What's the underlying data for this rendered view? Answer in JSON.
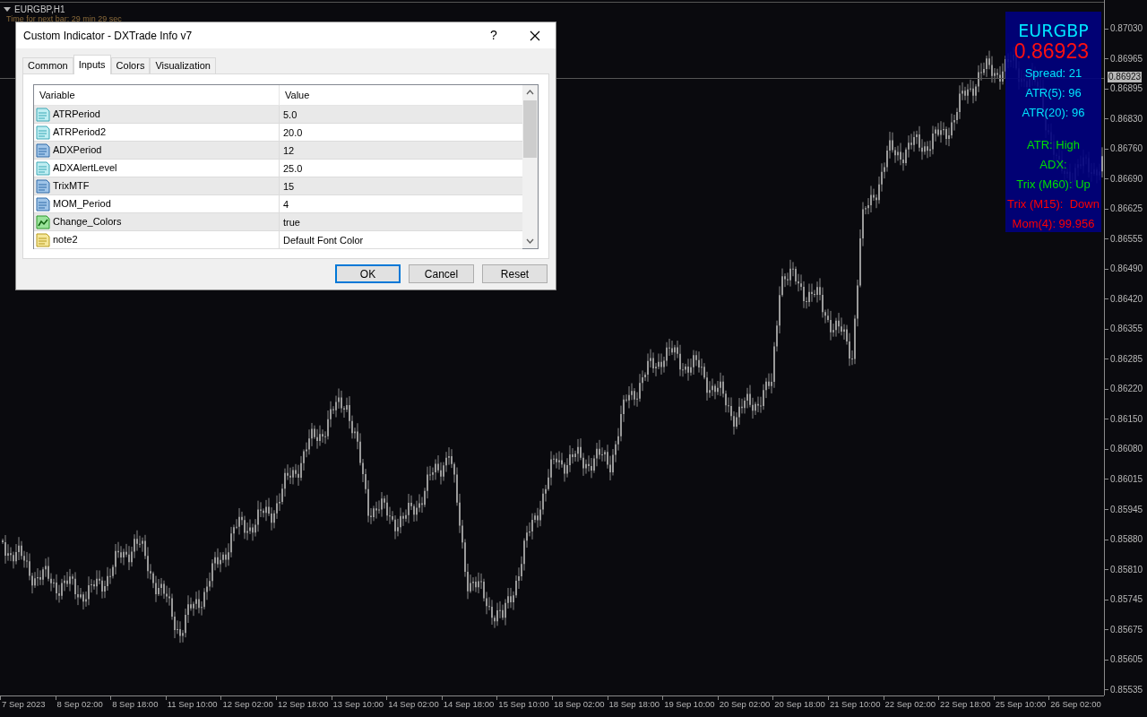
{
  "chart": {
    "symbol_title": "EURGBP,H1",
    "timer_text": "Time for next bar: 29 min 29 sec",
    "current_price": "0.86923",
    "price_labels": [
      "0.87030",
      "0.86965",
      "0.86895",
      "0.86830",
      "0.86760",
      "0.86690",
      "0.86625",
      "0.86555",
      "0.86490",
      "0.86420",
      "0.86355",
      "0.86285",
      "0.86220",
      "0.86150",
      "0.86080",
      "0.86015",
      "0.85945",
      "0.85880",
      "0.85810",
      "0.85745",
      "0.85675",
      "0.85605",
      "0.85535"
    ],
    "time_labels": [
      "7 Sep 2023",
      "8 Sep 02:00",
      "8 Sep 18:00",
      "11 Sep 10:00",
      "12 Sep 02:00",
      "12 Sep 18:00",
      "13 Sep 10:00",
      "14 Sep 02:00",
      "14 Sep 18:00",
      "15 Sep 10:00",
      "18 Sep 02:00",
      "18 Sep 18:00",
      "19 Sep 10:00",
      "20 Sep 02:00",
      "20 Sep 18:00",
      "21 Sep 10:00",
      "22 Sep 02:00",
      "22 Sep 18:00",
      "25 Sep 10:00",
      "26 Sep 02:00"
    ]
  },
  "info_panel": {
    "symbol": "EURGBP",
    "price": "0.86923",
    "blocks": [
      [
        {
          "text": "Spread: 21",
          "color": "#00e5ff"
        },
        {
          "text": "ATR(5): 96",
          "color": "#00e5ff"
        },
        {
          "text": "ATR(20): 96",
          "color": "#00e5ff"
        }
      ],
      [
        {
          "text": "ATR: High",
          "color": "#00e000"
        },
        {
          "text": "ADX:",
          "color": "#00e000"
        },
        {
          "text": "Trix (M60): Up",
          "color": "#00e000"
        },
        {
          "text": "Trix (M15):  Down",
          "color": "#ff0000"
        },
        {
          "text": "Mom(4): 99.956",
          "color": "#ff0000"
        }
      ]
    ]
  },
  "dialog": {
    "title": "Custom Indicator - DXTrade Info v7",
    "help": "?",
    "tabs": [
      {
        "label": "Common",
        "selected": false
      },
      {
        "label": "Inputs",
        "selected": true
      },
      {
        "label": "Colors",
        "selected": false
      },
      {
        "label": "Visualization",
        "selected": false
      }
    ],
    "columns": [
      "Variable",
      "Value"
    ],
    "rows": [
      {
        "kind": "double",
        "variable": "ATRPeriod",
        "value": "5.0"
      },
      {
        "kind": "double",
        "variable": "ATRPeriod2",
        "value": "20.0"
      },
      {
        "kind": "int",
        "variable": "ADXPeriod",
        "value": "12"
      },
      {
        "kind": "double",
        "variable": "ADXAlertLevel",
        "value": "25.0"
      },
      {
        "kind": "int",
        "variable": "TrixMTF",
        "value": "15"
      },
      {
        "kind": "int",
        "variable": "MOM_Period",
        "value": "4"
      },
      {
        "kind": "bool",
        "variable": "Change_Colors",
        "value": "true"
      },
      {
        "kind": "string",
        "variable": "note2",
        "value": "Default Font Color"
      }
    ],
    "buttons": [
      {
        "label": "OK",
        "default": true
      },
      {
        "label": "Cancel",
        "default": false
      },
      {
        "label": "Reset",
        "default": false
      }
    ]
  }
}
